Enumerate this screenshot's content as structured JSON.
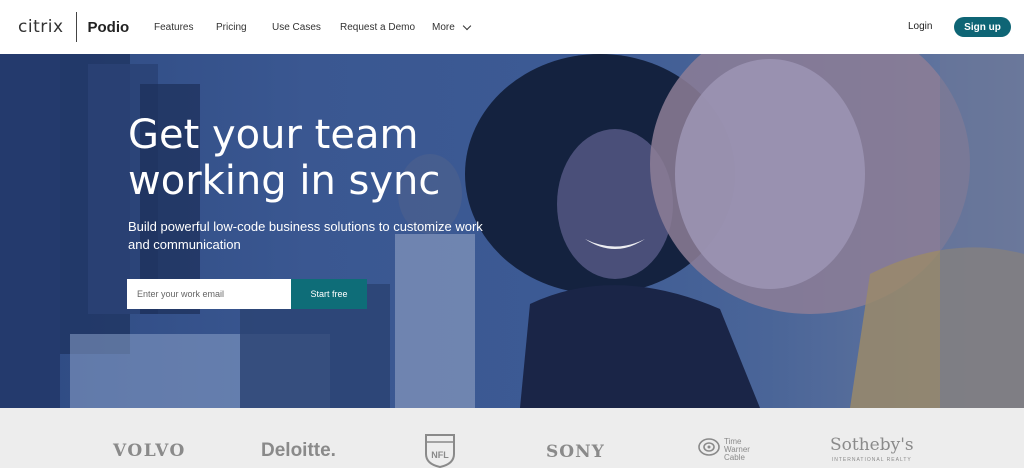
{
  "header": {
    "brand_citrix": "citrix",
    "brand_podio": "Podio",
    "nav": {
      "features": "Features",
      "pricing": "Pricing",
      "use_cases": "Use Cases",
      "request_demo": "Request a Demo",
      "more": "More"
    },
    "login": "Login",
    "signup": "Sign up"
  },
  "hero": {
    "title": "Get your team working in sync",
    "subtitle": "Build powerful low-code business solutions to customize work and communication",
    "email_placeholder": "Enter your work email",
    "start_button": "Start free"
  },
  "logos": {
    "volvo": "VOLVO",
    "deloitte": "Deloitte.",
    "nfl": "NFL",
    "sony": "SONY",
    "twc_line1": "Time",
    "twc_line2": "Warner",
    "twc_line3": "Cable",
    "sothebys": "Sotheby's",
    "sothebys_sub": "INTERNATIONAL REALTY"
  },
  "colors": {
    "accent": "#0e6575",
    "hero_overlay": "#3a5791"
  }
}
